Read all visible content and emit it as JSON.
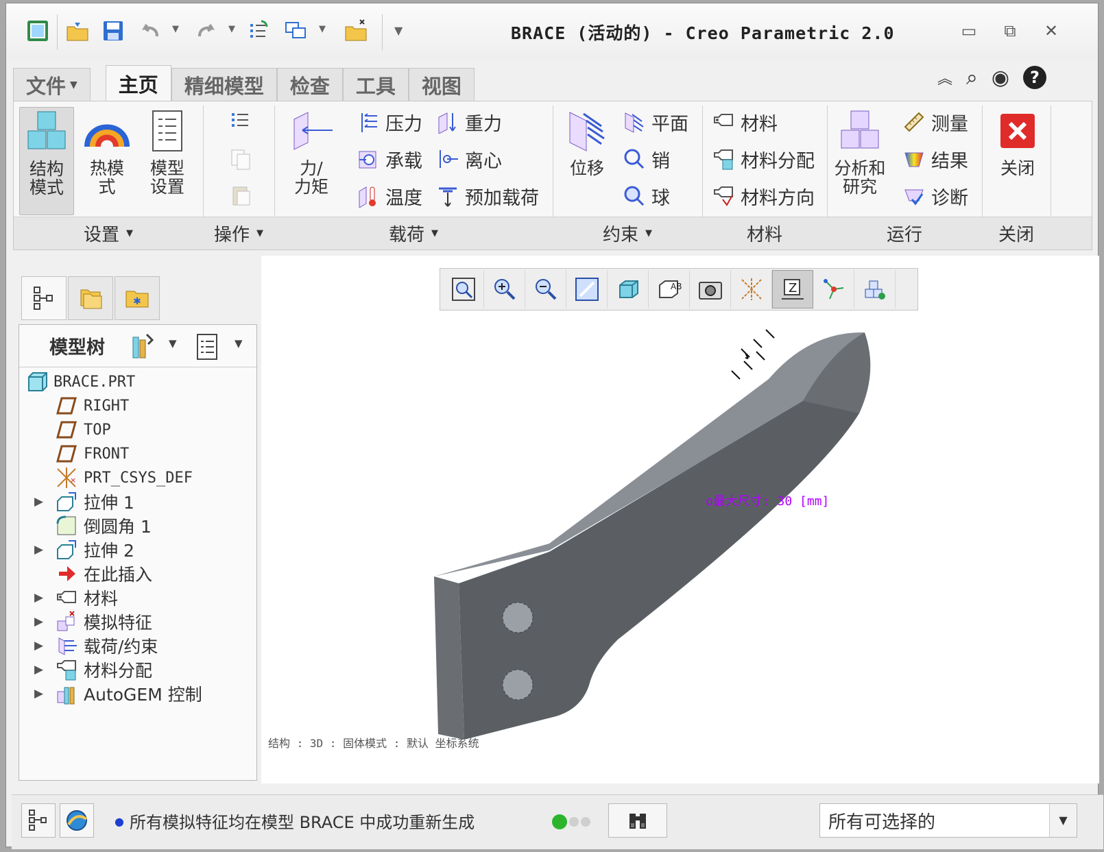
{
  "window": {
    "title": "BRACE (活动的) - Creo Parametric 2.0",
    "controls": [
      "minimize",
      "restore",
      "close"
    ]
  },
  "tabs": [
    {
      "label": "文件",
      "dropdown": true
    },
    {
      "label": "主页",
      "active": true
    },
    {
      "label": "精细模型"
    },
    {
      "label": "检查"
    },
    {
      "label": "工具"
    },
    {
      "label": "视图"
    }
  ],
  "ribbon": {
    "setup": {
      "group_label": "设置",
      "structure_mode": "结构\n模式",
      "thermal_mode": "热模\n式",
      "model_setup": "模型\n设置"
    },
    "operations": {
      "group_label": "操作"
    },
    "loads": {
      "group_label": "载荷",
      "force_moment": "力/\n力矩",
      "pressure": "压力",
      "gravity": "重力",
      "bearing": "承载",
      "centrifugal": "离心",
      "temperature": "温度",
      "preload": "预加载荷"
    },
    "constraints": {
      "group_label": "约束",
      "displacement": "位移",
      "planar": "平面",
      "pin": "销",
      "ball": "球"
    },
    "materials": {
      "group_label": "材料",
      "material": "材料",
      "material_assignment": "材料分配",
      "material_orientation": "材料方向"
    },
    "run": {
      "group_label": "运行",
      "analyses_studies": "分析和\n研究",
      "measure": "测量",
      "results": "结果",
      "diagnostics": "诊断"
    },
    "close": {
      "group_label": "关闭",
      "close_label": "关闭"
    }
  },
  "model_tree": {
    "title": "模型树",
    "items": [
      {
        "label": "BRACE.PRT",
        "icon": "part-icon",
        "level": 0,
        "expandable": false
      },
      {
        "label": "RIGHT",
        "icon": "datum-plane-icon",
        "level": 1,
        "expandable": false
      },
      {
        "label": "TOP",
        "icon": "datum-plane-icon",
        "level": 1,
        "expandable": false
      },
      {
        "label": "FRONT",
        "icon": "datum-plane-icon",
        "level": 1,
        "expandable": false
      },
      {
        "label": "PRT_CSYS_DEF",
        "icon": "csys-icon",
        "level": 1,
        "expandable": false
      },
      {
        "label": "拉伸 1",
        "icon": "extrude-icon",
        "level": 1,
        "expandable": true
      },
      {
        "label": "倒圆角 1",
        "icon": "round-icon",
        "level": 1,
        "expandable": false
      },
      {
        "label": "拉伸 2",
        "icon": "extrude-icon",
        "level": 1,
        "expandable": true
      },
      {
        "label": "在此插入",
        "icon": "insert-here-icon",
        "level": 1,
        "expandable": false
      },
      {
        "label": "材料",
        "icon": "material-icon",
        "level": 1,
        "expandable": true
      },
      {
        "label": "模拟特征",
        "icon": "sim-features-icon",
        "level": 1,
        "expandable": true
      },
      {
        "label": "载荷/约束",
        "icon": "loads-constraints-icon",
        "level": 1,
        "expandable": true
      },
      {
        "label": "材料分配",
        "icon": "material-assign-icon",
        "level": 1,
        "expandable": true
      },
      {
        "label": "AutoGEM 控制",
        "icon": "autogem-icon",
        "level": 1,
        "expandable": true
      }
    ]
  },
  "graphics": {
    "annotation": "o最大尺寸: 30 [mm]",
    "view_info": "结构 : 3D : 固体模式 : 默认 坐标系统"
  },
  "status_bar": {
    "message": "所有模拟特征均在模型 BRACE 中成功重新生成",
    "selection_filter": "所有可选择的",
    "colors": {
      "light_on": "#2cb52c",
      "light_off": "#cfcfcf",
      "msg_dot": "#1d3fd1"
    }
  },
  "colors": {
    "model_face_dark": "#5b5f64",
    "model_face_top": "#8a8f95",
    "model_face_front": "#6a6e73",
    "annotation": "#b000ff",
    "close_button": "#e02b2b"
  }
}
